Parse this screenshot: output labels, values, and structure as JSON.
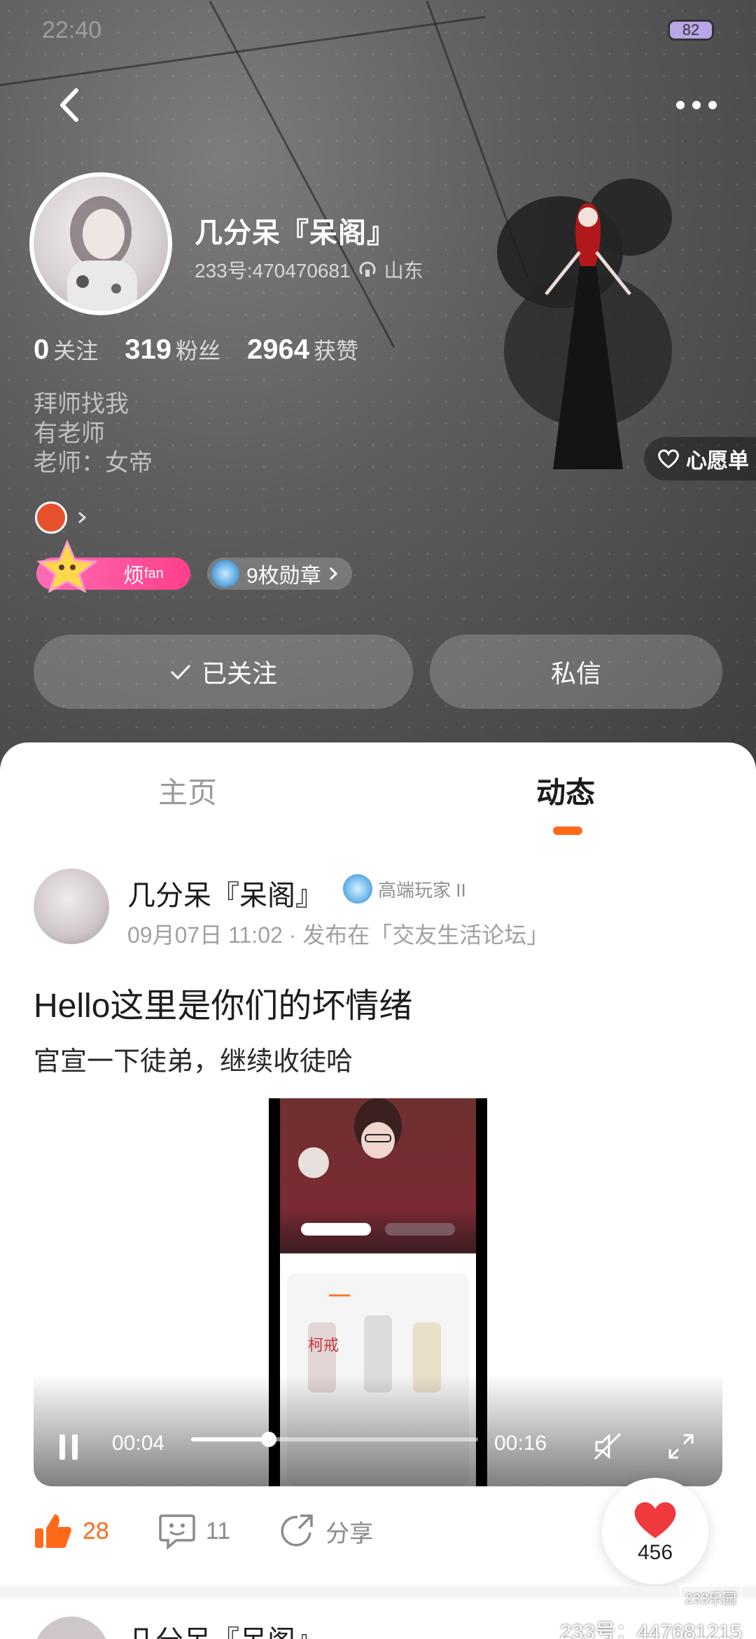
{
  "status_bar": {
    "time": "22:40",
    "battery": "82"
  },
  "profile": {
    "name": "几分呆『呆阁』",
    "uid": "233号:470470681",
    "location": "山东",
    "stats": [
      {
        "value": "0",
        "label": "关注"
      },
      {
        "value": "319",
        "label": "粉丝"
      },
      {
        "value": "2964",
        "label": "获赞"
      }
    ],
    "bio": [
      "拜师找我",
      "有老师",
      "老师：女帝"
    ],
    "fan_badge": "烦",
    "fan_sup": "fan",
    "medals": "9枚勋章",
    "follow_label": "已关注",
    "message_label": "私信",
    "wishlist": "心愿单"
  },
  "tabs": [
    {
      "label": "主页",
      "active": false
    },
    {
      "label": "动态",
      "active": true
    }
  ],
  "post": {
    "author": "几分呆『呆阁』",
    "level": "高端玩家 II",
    "meta": "09月07日 11:02 · 发布在「交友生活论坛」",
    "title": "Hello这里是你们的坏情绪",
    "body": "官宣一下徒弟，继续收徒哈",
    "video": {
      "current": "00:04",
      "duration": "00:16",
      "progress": 0.27
    },
    "likes": "28",
    "comments": "11",
    "share": "分享",
    "heart_count": "456"
  },
  "next_post": {
    "author": "几分呆『呆阁』"
  },
  "watermark": {
    "logo": "233乐园",
    "text": "233号：447681215"
  },
  "colors": {
    "accent": "#ff6a1a",
    "fan_pink": "#ff4f97",
    "heart": "#f0393c"
  }
}
